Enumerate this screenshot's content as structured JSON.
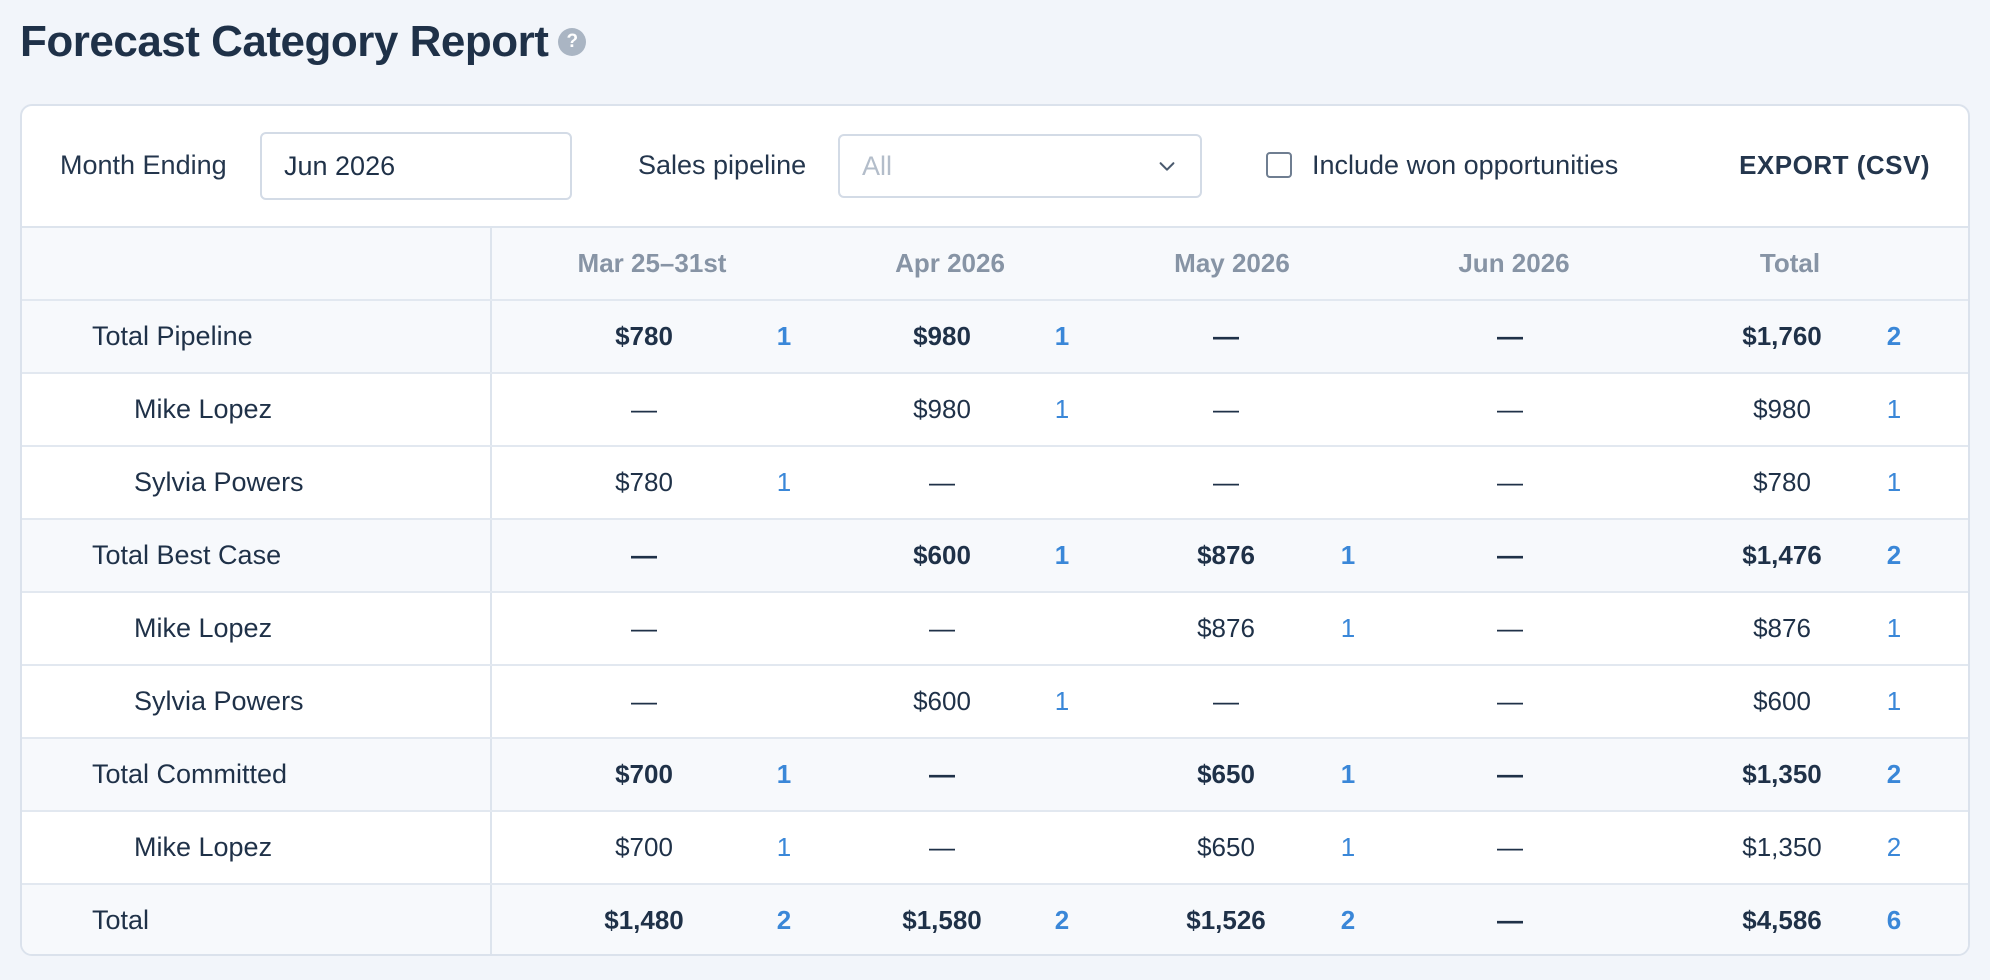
{
  "page": {
    "title": "Forecast Category Report"
  },
  "filters": {
    "month_label": "Month Ending",
    "month_value": "Jun 2026",
    "pipeline_label": "Sales pipeline",
    "pipeline_value": "All",
    "include_won_label": "Include won opportunities",
    "include_won_checked": false,
    "export_label": "EXPORT (CSV)"
  },
  "table": {
    "columns": [
      "Mar 25–31st",
      "Apr 2026",
      "May 2026",
      "Jun 2026",
      "Total"
    ],
    "rows": [
      {
        "kind": "group",
        "label": "Total Pipeline",
        "cells": [
          [
            "$780",
            "1"
          ],
          [
            "$980",
            "1"
          ],
          [
            "—",
            ""
          ],
          [
            "—",
            ""
          ],
          [
            "$1,760",
            "2"
          ]
        ]
      },
      {
        "kind": "person",
        "label": "Mike Lopez",
        "cells": [
          [
            "—",
            ""
          ],
          [
            "$980",
            "1"
          ],
          [
            "—",
            ""
          ],
          [
            "—",
            ""
          ],
          [
            "$980",
            "1"
          ]
        ]
      },
      {
        "kind": "person",
        "label": "Sylvia Powers",
        "cells": [
          [
            "$780",
            "1"
          ],
          [
            "—",
            ""
          ],
          [
            "—",
            ""
          ],
          [
            "—",
            ""
          ],
          [
            "$780",
            "1"
          ]
        ]
      },
      {
        "kind": "group",
        "label": "Total Best Case",
        "cells": [
          [
            "—",
            ""
          ],
          [
            "$600",
            "1"
          ],
          [
            "$876",
            "1"
          ],
          [
            "—",
            ""
          ],
          [
            "$1,476",
            "2"
          ]
        ]
      },
      {
        "kind": "person",
        "label": "Mike Lopez",
        "cells": [
          [
            "—",
            ""
          ],
          [
            "—",
            ""
          ],
          [
            "$876",
            "1"
          ],
          [
            "—",
            ""
          ],
          [
            "$876",
            "1"
          ]
        ]
      },
      {
        "kind": "person",
        "label": "Sylvia Powers",
        "cells": [
          [
            "—",
            ""
          ],
          [
            "$600",
            "1"
          ],
          [
            "—",
            ""
          ],
          [
            "—",
            ""
          ],
          [
            "$600",
            "1"
          ]
        ]
      },
      {
        "kind": "group",
        "label": "Total Committed",
        "cells": [
          [
            "$700",
            "1"
          ],
          [
            "—",
            ""
          ],
          [
            "$650",
            "1"
          ],
          [
            "—",
            ""
          ],
          [
            "$1,350",
            "2"
          ]
        ]
      },
      {
        "kind": "person",
        "label": "Mike Lopez",
        "cells": [
          [
            "$700",
            "1"
          ],
          [
            "—",
            ""
          ],
          [
            "$650",
            "1"
          ],
          [
            "—",
            ""
          ],
          [
            "$1,350",
            "2"
          ]
        ]
      },
      {
        "kind": "total",
        "label": "Total",
        "cells": [
          [
            "$1,480",
            "2"
          ],
          [
            "$1,580",
            "2"
          ],
          [
            "$1,526",
            "2"
          ],
          [
            "—",
            ""
          ],
          [
            "$4,586",
            "6"
          ]
        ]
      }
    ]
  }
}
